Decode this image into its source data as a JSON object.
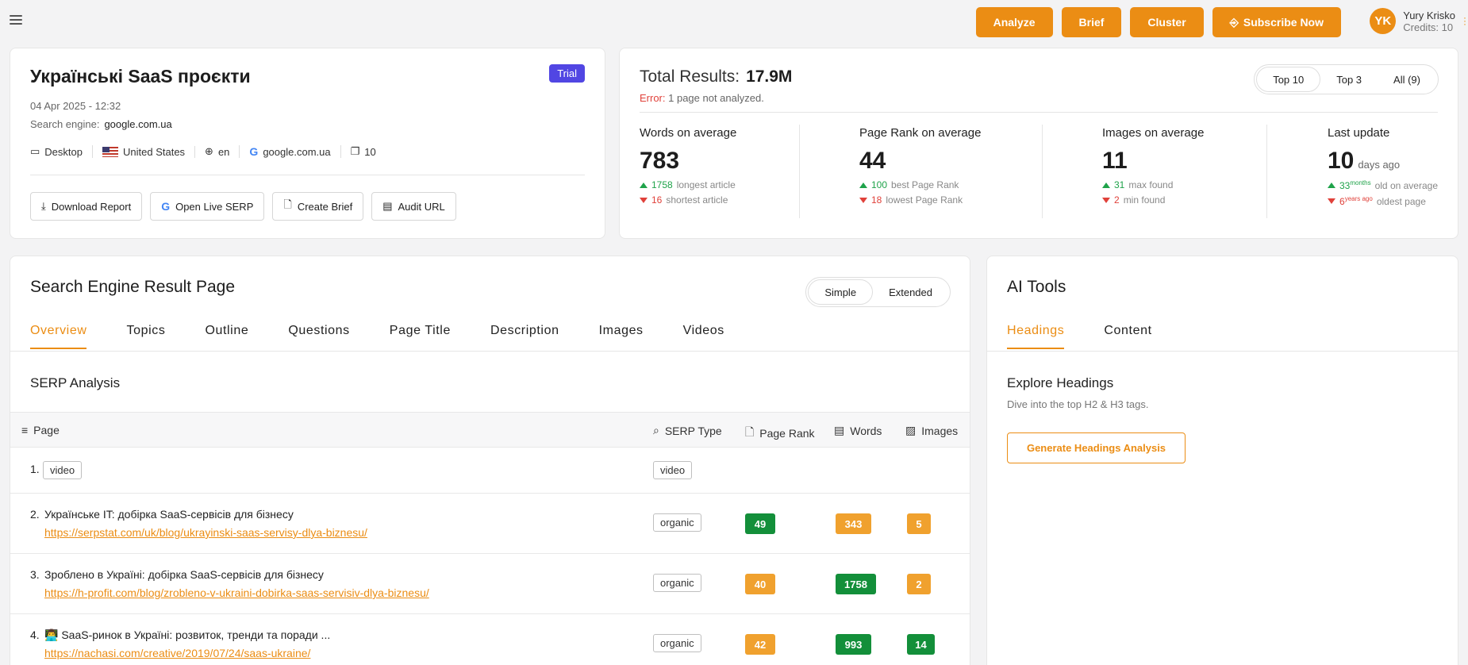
{
  "header": {
    "buttons": [
      "Analyze",
      "Brief",
      "Cluster",
      "Subscribe Now"
    ],
    "user_initials": "YK",
    "user_name": "Yury Krisko",
    "credits": "Credits: 10"
  },
  "project": {
    "title": "Українські SaaS проєкти",
    "badge": "Trial",
    "date": "04 Apr 2025 - 12:32",
    "engine_label": "Search engine:",
    "engine_value": "google.com.ua",
    "meta": [
      "Desktop",
      "United States",
      "en",
      "google.com.ua",
      "10"
    ],
    "actions": [
      "Download Report",
      "Open Live SERP",
      "Create Brief",
      "Audit URL"
    ]
  },
  "stats": {
    "total_label": "Total Results:",
    "total_value": "17.9M",
    "error_label": "Error:",
    "error_text": "1 page not analyzed.",
    "filters": [
      "Top 10",
      "Top 3",
      "All (9)"
    ],
    "words": {
      "label": "Words on average",
      "value": "783",
      "max": "1758",
      "max_text": "longest article",
      "min": "16",
      "min_text": "shortest article"
    },
    "rank": {
      "label": "Page Rank on average",
      "value": "44",
      "max": "100",
      "max_text": "best Page Rank",
      "min": "18",
      "min_text": "lowest Page Rank"
    },
    "images": {
      "label": "Images on average",
      "value": "11",
      "max": "31",
      "max_text": "max found",
      "min": "2",
      "min_text": "min found"
    },
    "update": {
      "label": "Last update",
      "value": "10",
      "unit": "days ago",
      "max": "33",
      "max_unit": "months",
      "max_text": "old on average",
      "min": "6",
      "min_unit": "years ago",
      "min_text": "oldest page"
    }
  },
  "serp": {
    "title": "Search Engine Result Page",
    "modes": [
      "Simple",
      "Extended"
    ],
    "tabs": [
      "Overview",
      "Topics",
      "Outline",
      "Questions",
      "Page Title",
      "Description",
      "Images",
      "Videos"
    ],
    "subtitle": "SERP Analysis",
    "columns": [
      "Page",
      "SERP Type",
      "Page Rank",
      "Words",
      "Images"
    ],
    "rows": [
      {
        "num": "1.",
        "title": "",
        "tag": "video",
        "url": "",
        "type": "video",
        "rank": "",
        "words": "",
        "images": ""
      },
      {
        "num": "2.",
        "title": "Українське IT: добірка SaaS-сервісів для бізнесу",
        "url": "https://serpstat.com/uk/blog/ukrayinski-saas-servisy-dlya-biznesu/",
        "type": "organic",
        "rank": "49",
        "words": "343",
        "images": "5"
      },
      {
        "num": "3.",
        "title": "Зроблено в Україні: добірка SaaS-сервісів для бізнесу",
        "url": "https://h-profit.com/blog/zrobleno-v-ukraini-dobirka-saas-servisiv-dlya-biznesu/",
        "type": "organic",
        "rank": "40",
        "words": "1758",
        "images": "2"
      },
      {
        "num": "4.",
        "title": "👨‍💻 SaaS-ринок в Україні: розвиток, тренди та поради ...",
        "url": "https://nachasi.com/creative/2019/07/24/saas-ukraine/",
        "type": "organic",
        "rank": "42",
        "words": "993",
        "images": "14"
      }
    ]
  },
  "ai": {
    "title": "AI Tools",
    "tabs": [
      "Headings",
      "Content"
    ],
    "heading": "Explore Headings",
    "desc": "Dive into the top H2 & H3 tags.",
    "button": "Generate Headings Analysis"
  },
  "colors": {
    "accent": "#eb8d14",
    "trial": "#5146e3",
    "green": "#138f3a",
    "orange": "#f0a12e"
  }
}
